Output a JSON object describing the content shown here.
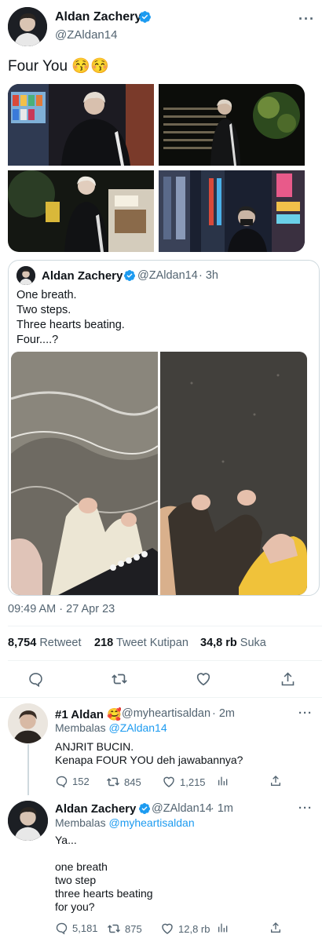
{
  "tweet": {
    "author_name": "Aldan Zachery",
    "author_handle": "@ZAldan14",
    "text": "Four You 😚😚",
    "timestamp": "09:49 AM · 27 Apr 23",
    "stats": {
      "retweets": "8,754",
      "retweets_label": "Retweet",
      "quotes": "218",
      "quotes_label": "Tweet Kutipan",
      "likes": "34,8 rb",
      "likes_label": "Suka"
    }
  },
  "quoted_tweet": {
    "author_name": "Aldan Zachery",
    "author_handle": "@ZAldan14",
    "time": "· 3h",
    "lines": [
      "One breath.",
      "Two steps.",
      "Three hearts beating.",
      "Four....?"
    ]
  },
  "replies": [
    {
      "author_name": "#1 Aldan 🥰",
      "author_handle": "@myheartisaldan",
      "time": "· 2m",
      "replying_prefix": "Membalas",
      "replying_to": "@ZAldan14",
      "text": "ANJRIT BUCIN.\nKenapa FOUR YOU deh jawabannya?",
      "replies_count": "152",
      "retweets_count": "845",
      "likes_count": "1,215"
    },
    {
      "author_name": "Aldan Zachery",
      "author_handle": "@ZAldan14",
      "time": "· 1m",
      "replying_prefix": "Membalas",
      "replying_to": "@myheartisaldan",
      "text": "Ya...\n\none breath\ntwo step\nthree hearts beating\nfor you?",
      "replies_count": "5,181",
      "retweets_count": "875",
      "likes_count": "12,8 rb"
    }
  ],
  "icons": {
    "more": "more-icon",
    "verified": "verified-badge-icon",
    "reply": "reply-icon",
    "retweet": "retweet-icon",
    "like": "heart-icon",
    "share": "share-icon",
    "analytics": "analytics-icon"
  },
  "colors": {
    "accent": "#1d9bf0",
    "text_primary": "#0f1419",
    "text_secondary": "#536471",
    "border": "#cfd9de"
  }
}
